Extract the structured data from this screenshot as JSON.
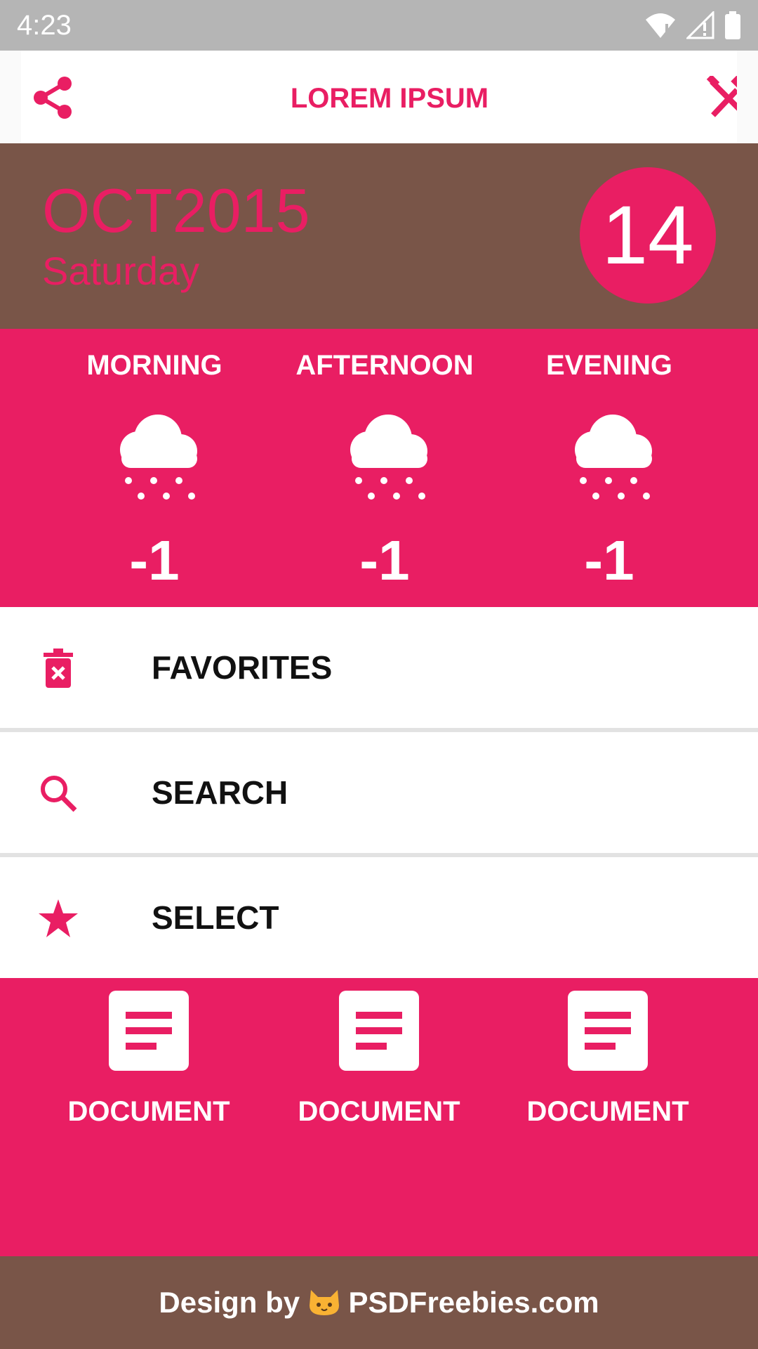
{
  "status_bar": {
    "time": "4:23",
    "icons": [
      "wifi-icon",
      "signal-icon",
      "battery-icon"
    ]
  },
  "app_bar": {
    "title": "LOREM IPSUM",
    "left_icon": "share-icon",
    "right_icon": "tools-icon"
  },
  "date": {
    "month_year": "OCT2015",
    "weekday": "Saturday",
    "day": "14"
  },
  "weather": [
    {
      "label": "MORNING",
      "icon": "snow-cloud-icon",
      "temp": "-1"
    },
    {
      "label": "AFTERNOON",
      "icon": "snow-cloud-icon",
      "temp": "-1"
    },
    {
      "label": "EVENING",
      "icon": "snow-cloud-icon",
      "temp": "-1"
    }
  ],
  "menu": [
    {
      "label": "FAVORITES",
      "icon": "trash-icon"
    },
    {
      "label": "SEARCH",
      "icon": "search-icon"
    },
    {
      "label": "SELECT",
      "icon": "star-icon"
    }
  ],
  "documents": [
    {
      "label": "DOCUMENT",
      "icon": "document-icon"
    },
    {
      "label": "DOCUMENT",
      "icon": "document-icon"
    },
    {
      "label": "DOCUMENT",
      "icon": "document-icon"
    }
  ],
  "footer": {
    "prefix": "Design by",
    "suffix": "PSDFreebies.com",
    "icon": "cat-icon"
  },
  "colors": {
    "accent": "#e91e63",
    "brown": "#795548",
    "status_bar": "#b5b5b5"
  }
}
